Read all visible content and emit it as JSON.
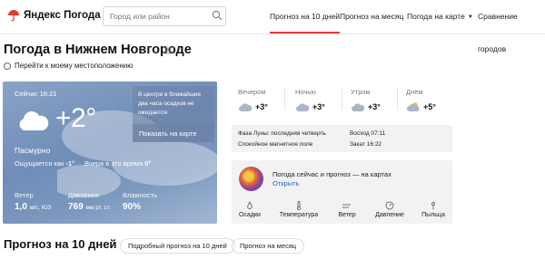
{
  "header": {
    "logo_text": "Яндекс Погода",
    "search_placeholder": "Город или район",
    "nav": [
      {
        "label": "Прогноз на 10 дней",
        "active": true
      },
      {
        "label": "Прогноз на месяц",
        "active": false
      },
      {
        "label": "Погода на карте",
        "active": false
      },
      {
        "label": "Сравнение городов",
        "active": false
      }
    ]
  },
  "page": {
    "title": "Погода в Нижнем Новгороде",
    "location_link": "Перейти к моему местоположению"
  },
  "now": {
    "time": "Сейчас 16:21",
    "temp": "+2°",
    "condition": "Пасмурно",
    "feels_label": "Ощущается как",
    "feels_value": "-1°",
    "yesterday_label": "Вчера в это время",
    "yesterday_value": "0°",
    "tip_text": "В центре в ближайшие два часа осадков не ожидается",
    "map_button": "Показать на карте",
    "wind_label": "Ветер",
    "wind_value": "1,0",
    "wind_unit": "м/с, ЮЗ",
    "pressure_label": "Давление",
    "pressure_value": "769",
    "pressure_unit": "мм рт. ст.",
    "humidity_label": "Влажность",
    "humidity_value": "90%"
  },
  "parts": [
    {
      "label": "Вечером",
      "temp": "+3°",
      "icon": "cloud-icon"
    },
    {
      "label": "Ночью",
      "temp": "+3°",
      "icon": "cloud-icon"
    },
    {
      "label": "Утром",
      "temp": "+3°",
      "icon": "cloud-icon"
    },
    {
      "label": "Днём",
      "temp": "+5°",
      "icon": "partly-cloudy-icon"
    }
  ],
  "info": {
    "moon": "Фаза Луны: последняя четверть",
    "magnetic": "Спокойное магнитное поле",
    "sunrise": "Восход 07:11",
    "sunset": "Закат 16:22"
  },
  "maps": {
    "title": "Погода сейчас и прогноз — на картах",
    "open": "Открыть",
    "layers": [
      "Осадки",
      "Температура",
      "Ветер",
      "Давление",
      "Пыльца"
    ]
  },
  "forecast": {
    "title": "Прогноз на 10 дней",
    "detail_button": "Подробный прогноз на 10 дней",
    "month_button": "Прогноз на месяц"
  },
  "colors": {
    "accent": "#e53935",
    "link": "#2a64c8",
    "card": "#7c98bf"
  }
}
